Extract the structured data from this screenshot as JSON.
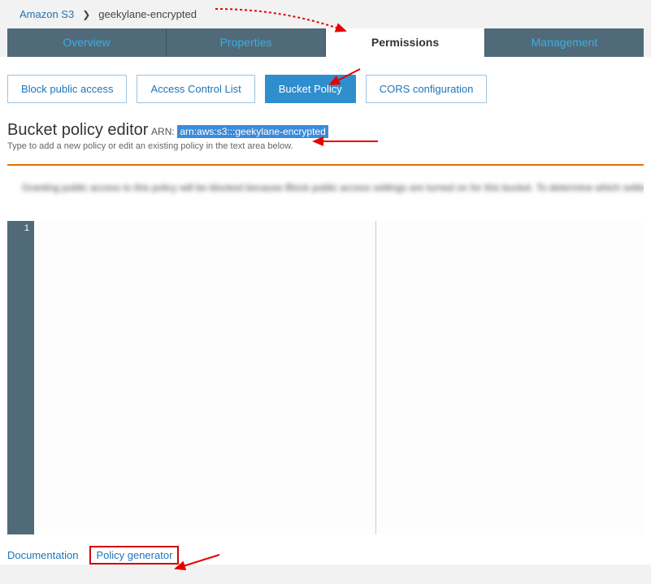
{
  "breadcrumb": {
    "root": "Amazon S3",
    "current": "geekylane-encrypted"
  },
  "tabs": {
    "overview": "Overview",
    "properties": "Properties",
    "permissions": "Permissions",
    "management": "Management"
  },
  "subnav": {
    "block_public": "Block public access",
    "acl": "Access Control List",
    "bucket_policy": "Bucket Policy",
    "cors": "CORS configuration"
  },
  "editor": {
    "title": "Bucket policy editor",
    "arn_label": "ARN:",
    "arn_value": "arn:aws:s3:::geekylane-encrypted",
    "note": "Type to add a new policy or edit an existing policy in the text area below."
  },
  "warning": {
    "blurred_text": "Granting public access to this policy will be blocked because Block public access settings are turned on for this bucket. To determine which settings"
  },
  "gutter": {
    "line1": "1"
  },
  "footer": {
    "documentation": "Documentation",
    "policy_generator": "Policy generator"
  }
}
